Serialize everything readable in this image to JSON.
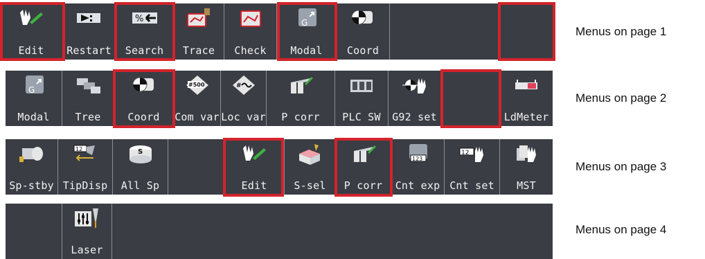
{
  "colors": {
    "bar": "#3a3d44",
    "divider": "#8a8e96",
    "highlight": "#d4232b",
    "label": "#f2f2f2"
  },
  "page1": {
    "caption": "Menus on page 1",
    "items": [
      {
        "label": "Edit",
        "icon": "edit-hand-pen-icon",
        "highlighted": true
      },
      {
        "label": "Restart",
        "icon": "restart-arrow-icon",
        "highlighted": false
      },
      {
        "label": "Search",
        "icon": "search-percent-arrow-icon",
        "highlighted": true
      },
      {
        "label": "Trace",
        "icon": "trace-machine-icon",
        "highlighted": false
      },
      {
        "label": "Check",
        "icon": "check-path-icon",
        "highlighted": false
      },
      {
        "label": "Modal",
        "icon": "modal-g-icon",
        "highlighted": true
      },
      {
        "label": "Coord",
        "icon": "coord-icon",
        "highlighted": false
      },
      {
        "label": "",
        "icon": "",
        "highlighted": true
      }
    ]
  },
  "page2": {
    "caption": "Menus on page 2",
    "items": [
      {
        "label": "Modal",
        "icon": "modal-g-icon",
        "highlighted": false
      },
      {
        "label": "Tree",
        "icon": "tree-windows-icon",
        "highlighted": false
      },
      {
        "label": "Coord",
        "icon": "coord-icon",
        "highlighted": true
      },
      {
        "label": "Com var",
        "icon": "common-variable-500-icon",
        "highlighted": false
      },
      {
        "label": "Loc var",
        "icon": "local-variable-icon",
        "highlighted": false
      },
      {
        "label": "P corr",
        "icon": "p-correction-icon",
        "highlighted": false
      },
      {
        "label": "PLC SW",
        "icon": "plc-switch-icon",
        "highlighted": false
      },
      {
        "label": "G92 set",
        "icon": "g92-set-hand-icon",
        "highlighted": false
      },
      {
        "label": "",
        "icon": "",
        "highlighted": true
      },
      {
        "label": "LdMeter",
        "icon": "load-meter-icon",
        "highlighted": false
      }
    ]
  },
  "page3": {
    "caption": "Menus on page 3",
    "items": [
      {
        "label": "Sp-stby",
        "icon": "spindle-standby-icon",
        "highlighted": false
      },
      {
        "label": "TipDisp",
        "icon": "tip-display-icon",
        "highlighted": false
      },
      {
        "label": "All Sp",
        "icon": "all-spindle-s-icon",
        "highlighted": false
      },
      {
        "label": "",
        "icon": "",
        "highlighted": false
      },
      {
        "label": "Edit",
        "icon": "edit-hand-pen-icon",
        "highlighted": true
      },
      {
        "label": "S-sel",
        "icon": "spindle-select-icon",
        "highlighted": false
      },
      {
        "label": "P corr",
        "icon": "p-correction-icon",
        "highlighted": true
      },
      {
        "label": "Cnt exp",
        "icon": "counter-expand-icon",
        "highlighted": false
      },
      {
        "label": "Cnt set",
        "icon": "counter-set-icon",
        "highlighted": false
      },
      {
        "label": "MST",
        "icon": "mst-hand-icon",
        "highlighted": false
      }
    ]
  },
  "page4": {
    "caption": "Menus on page 4",
    "items": [
      {
        "label": "",
        "icon": "",
        "highlighted": false
      },
      {
        "label": "Laser",
        "icon": "laser-sliders-icon",
        "highlighted": false
      }
    ]
  }
}
